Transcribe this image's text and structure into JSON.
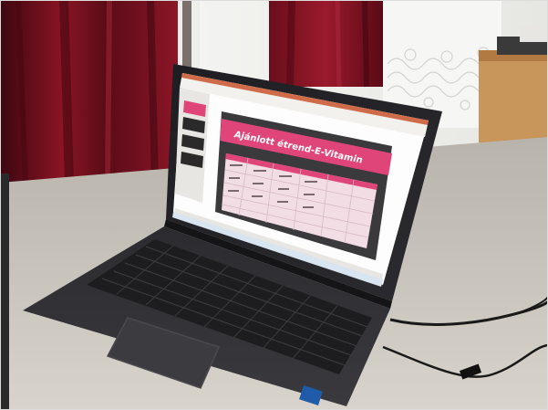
{
  "photo": {
    "description_tag": "laptop-on-table-photo",
    "slide": {
      "title": "Ajánlott étrend-E-Vitamin"
    },
    "colors": {
      "curtain": "#7a1020",
      "table": "#c8c4bc",
      "laptop_body": "#2b2b2e",
      "slide_accent": "#e0457a",
      "window_light": "#f2f2f0"
    }
  }
}
